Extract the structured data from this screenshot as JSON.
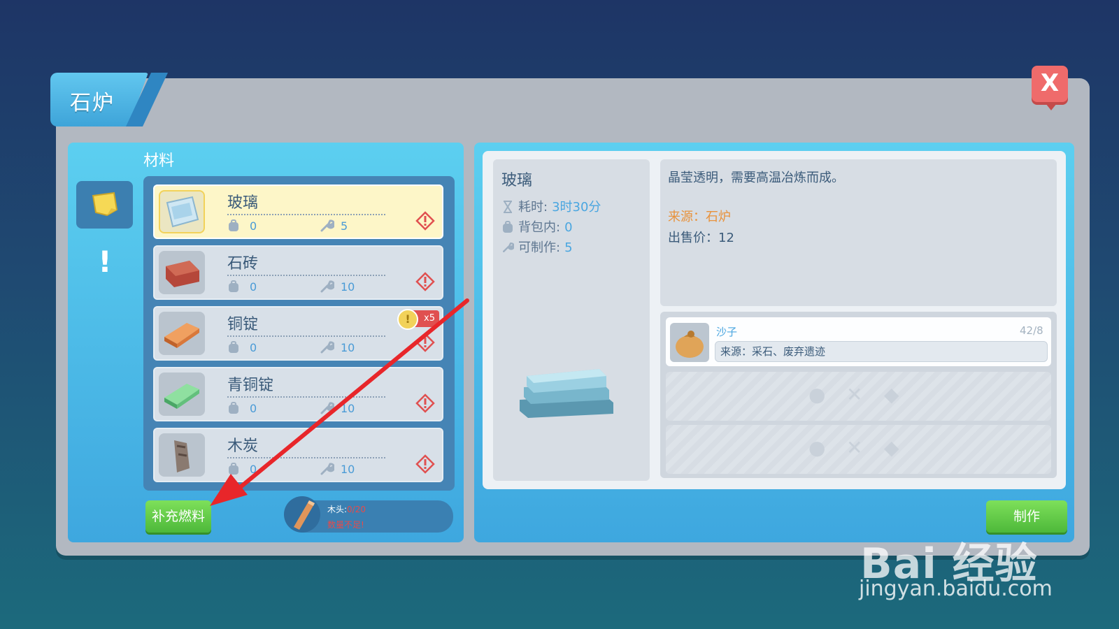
{
  "window": {
    "title": "石炉",
    "close_label": "X"
  },
  "sidebar": {
    "section_title": "材料",
    "alert_glyph": "!"
  },
  "items": [
    {
      "name": "玻璃",
      "bag": "0",
      "craftable": "5",
      "selected": true
    },
    {
      "name": "石砖",
      "bag": "0",
      "craftable": "10"
    },
    {
      "name": "铜锭",
      "bag": "0",
      "craftable": "10",
      "badge": "x5"
    },
    {
      "name": "青铜锭",
      "bag": "0",
      "craftable": "10"
    },
    {
      "name": "木炭",
      "bag": "0",
      "craftable": "10"
    }
  ],
  "fuel": {
    "button_label": "补充燃料",
    "wood_label": "木头:",
    "wood_value": "0/20",
    "warning": "数量不足!"
  },
  "detail": {
    "name": "玻璃",
    "time_label": "耗时:",
    "time_value": "3时30分",
    "bag_label": "背包内:",
    "bag_value": "0",
    "craft_label": "可制作:",
    "craft_value": "5",
    "description": "晶莹透明，需要高温冶炼而成。",
    "source": "来源：石炉",
    "price": "出售价：12"
  },
  "requirements": [
    {
      "name": "沙子",
      "count": "42/8",
      "source": "来源：采石、废弃遗迹"
    }
  ],
  "actions": {
    "craft_label": "制作"
  },
  "watermark": {
    "brand": "Bai 经验",
    "url": "jingyan.baidu.com"
  },
  "colors": {
    "accent": "#4db83a",
    "panel": "#3ea7df",
    "alert": "#e84a4a"
  }
}
